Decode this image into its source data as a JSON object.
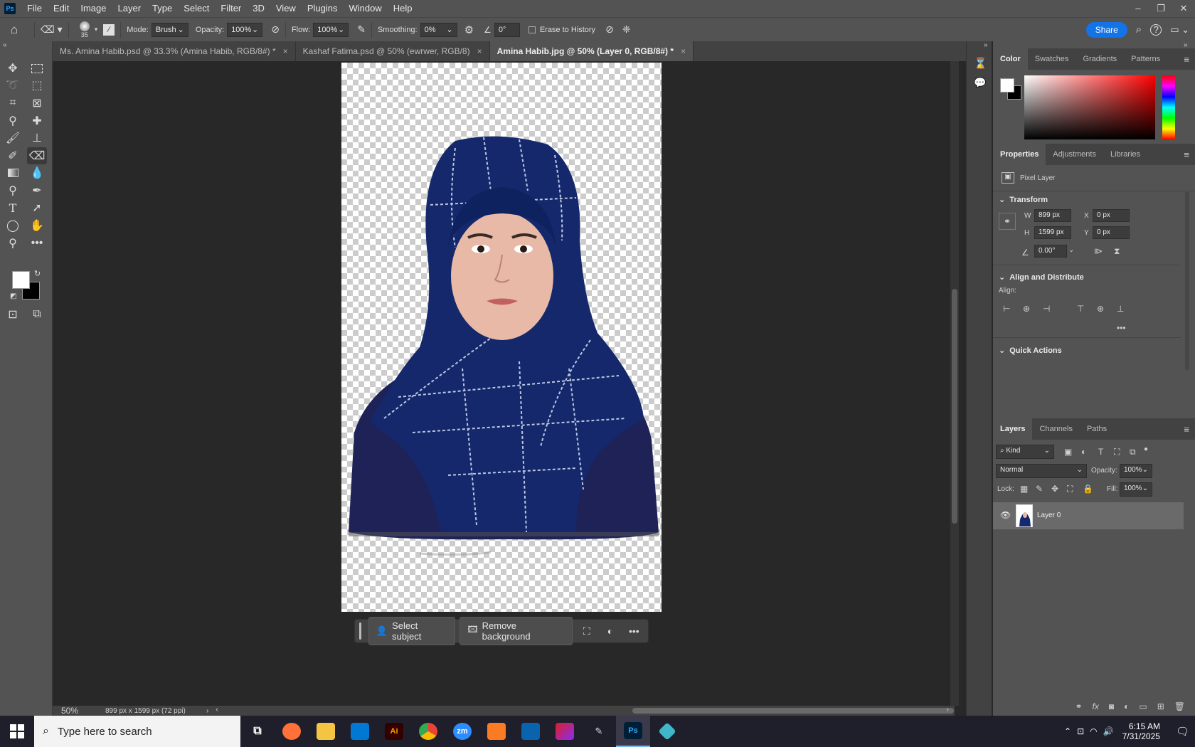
{
  "app": {
    "logo": "Ps",
    "menu": [
      "File",
      "Edit",
      "Image",
      "Layer",
      "Type",
      "Select",
      "Filter",
      "3D",
      "View",
      "Plugins",
      "Window",
      "Help"
    ],
    "window_controls": [
      "–",
      "❐",
      "✕"
    ]
  },
  "options": {
    "brush_size": "35",
    "mode_label": "Mode:",
    "mode_value": "Brush",
    "opacity_label": "Opacity:",
    "opacity_value": "100%",
    "flow_label": "Flow:",
    "flow_value": "100%",
    "smoothing_label": "Smoothing:",
    "smoothing_value": "0%",
    "angle_value": "0°",
    "erase_history_label": "Erase to History",
    "share_label": "Share"
  },
  "tabs": [
    {
      "label": "Ms. Amina Habib.psd @ 33.3% (Amina Habib, RGB/8#) *",
      "active": false
    },
    {
      "label": "Kashaf Fatima.psd @ 50% (ewrwer, RGB/8)",
      "active": false
    },
    {
      "label": "Amina Habib.jpg @ 50% (Layer 0, RGB/8#) *",
      "active": true
    }
  ],
  "context_bar": {
    "select_subject": "Select subject",
    "remove_background": "Remove background"
  },
  "status": {
    "zoom": "50%",
    "doc_info": "899 px x 1599 px (72 ppi)"
  },
  "color_panel": {
    "tabs": [
      "Color",
      "Swatches",
      "Gradients",
      "Patterns"
    ],
    "foreground": "#ffffff",
    "background": "#000000",
    "hue": "#ff0000"
  },
  "properties_panel": {
    "tabs": [
      "Properties",
      "Adjustments",
      "Libraries"
    ],
    "layer_type": "Pixel Layer",
    "transform_head": "Transform",
    "w_label": "W",
    "w_value": "899 px",
    "h_label": "H",
    "h_value": "1599 px",
    "x_label": "X",
    "x_value": "0 px",
    "y_label": "Y",
    "y_value": "0 px",
    "angle_value": "0.00°",
    "align_head": "Align and Distribute",
    "align_label": "Align:",
    "quick_head": "Quick Actions"
  },
  "layers_panel": {
    "tabs": [
      "Layers",
      "Channels",
      "Paths"
    ],
    "filter_kind": "Kind",
    "blend_mode": "Normal",
    "opacity_label": "Opacity:",
    "opacity_value": "100%",
    "lock_label": "Lock:",
    "fill_label": "Fill:",
    "fill_value": "100%",
    "layer_name": "Layer 0"
  },
  "taskbar": {
    "search_placeholder": "Type here to search",
    "time": "6:15 AM",
    "date": "7/31/2025",
    "apps": [
      "firefox",
      "files",
      "vscode",
      "Ai",
      "chrome",
      "zm",
      "xampp",
      "outlook",
      "cloud",
      "pen",
      "Ps",
      "app"
    ]
  }
}
